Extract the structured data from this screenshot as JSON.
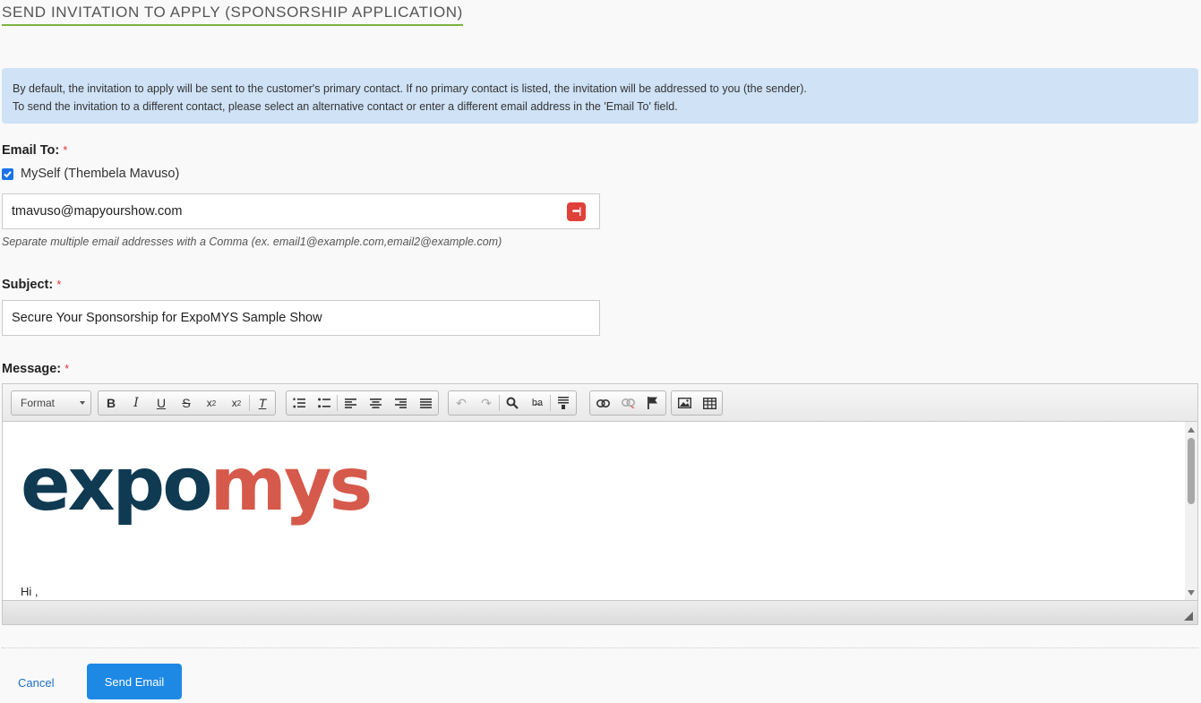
{
  "page": {
    "title": "SEND INVITATION TO APPLY (SPONSORSHIP APPLICATION)"
  },
  "info": {
    "line1": "By default, the invitation to apply will be sent to the customer's primary contact. If no primary contact is listed, the invitation will be addressed to you (the sender).",
    "line2": "To send the invitation to a different contact, please select an alternative contact or enter a different email address in the 'Email To' field."
  },
  "email_to": {
    "label": "Email To:",
    "required_mark": "*",
    "myself_label": "MySelf (Thembela Mavuso)",
    "myself_checked": true,
    "value": "tmavuso@mapyourshow.com",
    "help": "Separate multiple email addresses with a Comma (ex. email1@example.com,email2@example.com)"
  },
  "subject": {
    "label": "Subject:",
    "required_mark": "*",
    "value": "Secure Your Sponsorship for ExpoMYS Sample Show"
  },
  "message": {
    "label": "Message:",
    "required_mark": "*",
    "format_label": "Format",
    "logo_part1": "expo",
    "logo_part2": "mys",
    "greeting": "Hi ,"
  },
  "toolbar_icons": [
    "bold-icon",
    "italic-icon",
    "underline-icon",
    "strikethrough-icon",
    "subscript-icon",
    "superscript-icon",
    "remove-format-icon",
    "numbered-list-icon",
    "bulleted-list-icon",
    "align-left-icon",
    "align-center-icon",
    "align-right-icon",
    "justify-icon",
    "undo-icon",
    "redo-icon",
    "find-icon",
    "replace-icon",
    "page-break-icon",
    "link-icon",
    "unlink-icon",
    "anchor-icon",
    "image-icon",
    "table-icon"
  ],
  "actions": {
    "cancel_label": "Cancel",
    "send_label": "Send Email"
  },
  "colors": {
    "accent": "#1e88e5",
    "title_underline": "#7cb342",
    "info_bg": "#cfe2f6",
    "logo_dark": "#0f3a52",
    "logo_red": "#d65a4b"
  }
}
